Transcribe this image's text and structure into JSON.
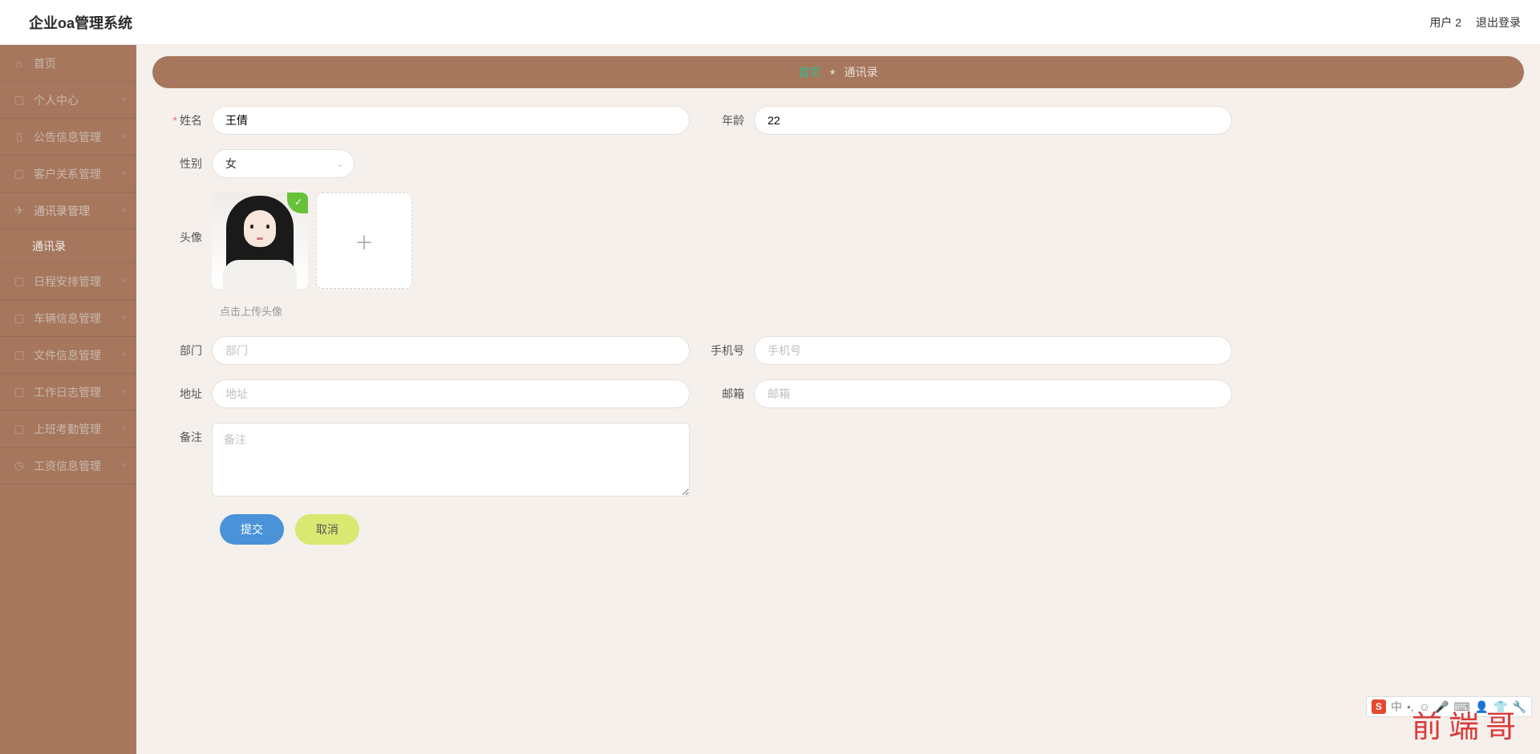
{
  "header": {
    "title": "企业oa管理系统",
    "user": "用户 2",
    "logout": "退出登录"
  },
  "sidebar": {
    "items": [
      {
        "icon": "home",
        "label": "首页",
        "hasArrow": false
      },
      {
        "icon": "user",
        "label": "个人中心",
        "hasArrow": true
      },
      {
        "icon": "chart",
        "label": "公告信息管理",
        "hasArrow": true
      },
      {
        "icon": "book",
        "label": "客户关系管理",
        "hasArrow": true
      },
      {
        "icon": "send",
        "label": "通讯录管理",
        "hasArrow": true,
        "expanded": true,
        "sub": [
          {
            "label": "通讯录",
            "active": true
          }
        ]
      },
      {
        "icon": "user",
        "label": "日程安排管理",
        "hasArrow": true
      },
      {
        "icon": "calendar",
        "label": "车辆信息管理",
        "hasArrow": true
      },
      {
        "icon": "file",
        "label": "文件信息管理",
        "hasArrow": true
      },
      {
        "icon": "grid",
        "label": "工作日志管理",
        "hasArrow": true
      },
      {
        "icon": "flag",
        "label": "上班考勤管理",
        "hasArrow": true
      },
      {
        "icon": "clock",
        "label": "工资信息管理",
        "hasArrow": true
      }
    ]
  },
  "breadcrumb": {
    "home": "首页",
    "current": "通讯录"
  },
  "form": {
    "name_label": "姓名",
    "name_value": "王倩",
    "age_label": "年龄",
    "age_value": "22",
    "gender_label": "性别",
    "gender_value": "女",
    "avatar_label": "头像",
    "upload_hint": "点击上传头像",
    "dept_label": "部门",
    "dept_placeholder": "部门",
    "phone_label": "手机号",
    "phone_placeholder": "手机号",
    "addr_label": "地址",
    "addr_placeholder": "地址",
    "email_label": "邮箱",
    "email_placeholder": "邮箱",
    "remark_label": "备注",
    "remark_placeholder": "备注"
  },
  "actions": {
    "submit": "提交",
    "cancel": "取消"
  },
  "watermark": "前端哥",
  "ime": {
    "logo": "S",
    "lang": "中"
  }
}
